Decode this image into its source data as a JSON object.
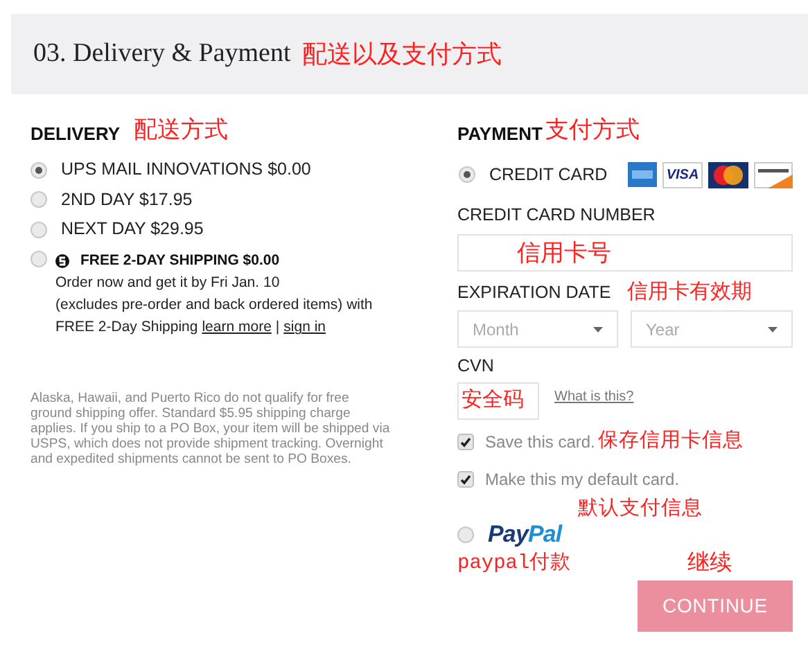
{
  "header": {
    "title": "03. Delivery & Payment",
    "note": "配送以及支付方式"
  },
  "delivery": {
    "heading": "DELIVERY",
    "note": "配送方式",
    "options": [
      {
        "kind": "simple",
        "label": "UPS MAIL INNOVATIONS $0.00",
        "selected": true
      },
      {
        "kind": "simple",
        "label": "2ND DAY $17.95",
        "selected": false
      },
      {
        "kind": "simple",
        "label": "NEXT DAY $29.95",
        "selected": false
      },
      {
        "kind": "promo",
        "label": "FREE 2-DAY SHIPPING $0.00",
        "selected": false,
        "lines": [
          "Order now and get it by Fri Jan. 10",
          "(excludes pre-order and back ordered items) with"
        ],
        "last_line": "FREE 2-Day Shipping",
        "links": [
          "learn more",
          "sign in"
        ],
        "separator": "|"
      }
    ],
    "disclaimer": "Alaska, Hawaii, and Puerto Rico do not qualify for free ground shipping offer. Standard $5.95 shipping charge applies. If you ship to a PO Box, your item will be shipped via USPS, which does not provide shipment tracking. Overnight and expedited shipments cannot be sent to PO Boxes."
  },
  "payment": {
    "heading": "PAYMENT",
    "note": "支付方式",
    "credit_card": {
      "label": "CREDIT CARD",
      "selected": true,
      "cards": [
        {
          "kind": "amex"
        },
        {
          "kind": "visa",
          "text": "VISA"
        },
        {
          "kind": "mastercard"
        },
        {
          "kind": "discover"
        }
      ]
    },
    "card_number": {
      "label": "CREDIT CARD NUMBER",
      "note": "信用卡号"
    },
    "expiration": {
      "label": "EXPIRATION DATE",
      "note": "信用卡有效期",
      "selects": [
        {
          "placeholder": "Month"
        },
        {
          "placeholder": "Year"
        }
      ]
    },
    "cvn": {
      "label": "CVN",
      "note": "安全码",
      "help_link": "What is this?"
    },
    "checkboxes": [
      {
        "label": "Save this card.",
        "checked": true,
        "note": "保存信用卡信息"
      },
      {
        "label": "Make this my default card.",
        "checked": true,
        "note": "默认支付信息"
      }
    ],
    "paypal": {
      "logo": {
        "first": "Pay",
        "second": "Pal"
      },
      "selected": false,
      "note": "paypal付款"
    },
    "continue": {
      "label": "CONTINUE",
      "note": "继续"
    }
  }
}
